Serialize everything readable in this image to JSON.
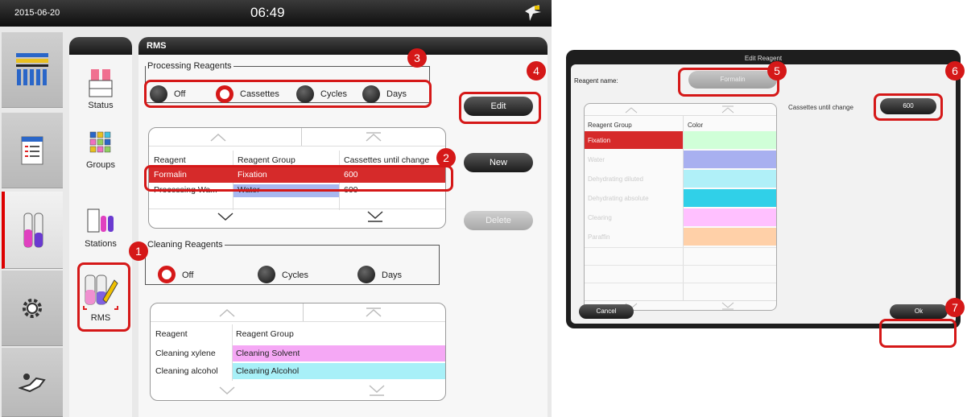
{
  "topbar": {
    "date": "2015-06-20",
    "time": "06:49"
  },
  "subnav": {
    "status": "Status",
    "groups": "Groups",
    "stations": "Stations",
    "rms": "RMS"
  },
  "panel": {
    "title": "RMS"
  },
  "processing": {
    "legend": "Processing Reagents",
    "options": [
      "Off",
      "Cassettes",
      "Cycles",
      "Days"
    ],
    "selected": "Cassettes",
    "headers": [
      "Reagent",
      "Reagent Group",
      "Cassettes until change"
    ],
    "rows": [
      {
        "reagent": "Formalin",
        "group": "Fixation",
        "value": "600",
        "color": "#d62a2a"
      },
      {
        "reagent": "Processing Wa...",
        "group": "Water",
        "value": "600",
        "color": "#a8b8f0"
      }
    ]
  },
  "cleaning": {
    "legend": "Cleaning Reagents",
    "options": [
      "Off",
      "Cycles",
      "Days"
    ],
    "selected": "Off",
    "headers": [
      "Reagent",
      "Reagent Group"
    ],
    "rows": [
      {
        "reagent": "Cleaning xylene",
        "group": "Cleaning Solvent",
        "color": "#f5a8f5"
      },
      {
        "reagent": "Cleaning alcohol",
        "group": "Cleaning Alcohol",
        "color": "#a8f0f8"
      }
    ]
  },
  "buttons": {
    "edit": "Edit",
    "new": "New",
    "delete": "Delete"
  },
  "badges": [
    "1",
    "2",
    "3",
    "4",
    "5",
    "6",
    "7"
  ],
  "dialog": {
    "title": "Edit Reagent",
    "name_label": "Reagent name:",
    "name_value": "Formalin",
    "table_headers": [
      "Reagent Group",
      "Color"
    ],
    "groups": [
      {
        "name": "Fixation",
        "color": "#d0ffd8"
      },
      {
        "name": "Water",
        "color": "#a8b0f0"
      },
      {
        "name": "Dehydrating diluted",
        "color": "#b0f0f8"
      },
      {
        "name": "Dehydrating absolute",
        "color": "#30d0e8"
      },
      {
        "name": "Clearing",
        "color": "#ffc0ff"
      },
      {
        "name": "Paraffin",
        "color": "#ffd0a8"
      }
    ],
    "cassettes_label": "Cassettes until change",
    "cassettes_value": "600",
    "cancel": "Cancel",
    "ok": "Ok"
  }
}
